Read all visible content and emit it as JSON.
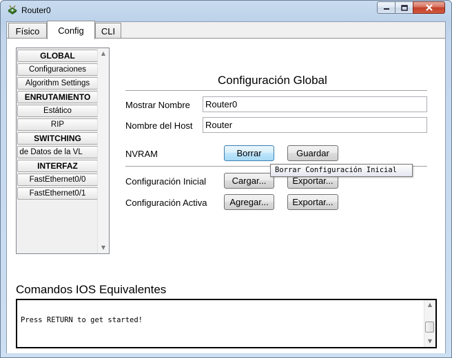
{
  "window": {
    "title": "Router0"
  },
  "tabs": [
    {
      "label": "Físico"
    },
    {
      "label": "Config"
    },
    {
      "label": "CLI"
    }
  ],
  "sidebar": {
    "items": [
      {
        "label": "GLOBAL",
        "header": true
      },
      {
        "label": "Configuraciones"
      },
      {
        "label": "Algorithm Settings"
      },
      {
        "label": "ENRUTAMIENTO",
        "header": true
      },
      {
        "label": "Estático"
      },
      {
        "label": "RIP"
      },
      {
        "label": "SWITCHING",
        "header": true
      },
      {
        "label": "se de Datos de la VL"
      },
      {
        "label": "INTERFAZ",
        "header": true
      },
      {
        "label": "FastEthernet0/0"
      },
      {
        "label": "FastEthernet0/1"
      }
    ]
  },
  "main": {
    "heading": "Configuración Global",
    "display_name_label": "Mostrar Nombre",
    "display_name_value": "Router0",
    "hostname_label": "Nombre del Host",
    "hostname_value": "Router",
    "nvram_label": "NVRAM",
    "erase_button": "Borrar",
    "save_button": "Guardar",
    "tooltip": "Borrar Configuración Inicial",
    "startup_label": "Configuración Inicial",
    "startup_load_button": "Cargar...",
    "startup_export_button": "Exportar...",
    "running_label": "Configuración Activa",
    "running_merge_button": "Agregar...",
    "running_export_button": "Exportar..."
  },
  "ios": {
    "title": "Comandos IOS Equivalentes",
    "console_text": "Press RETURN to get started!"
  }
}
